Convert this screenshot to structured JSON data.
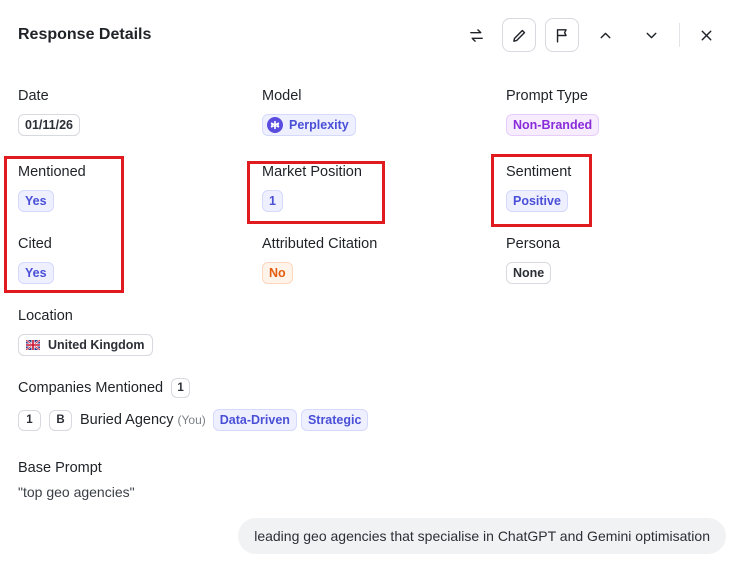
{
  "header": {
    "title": "Response Details",
    "icons": [
      "swap-arrows-icon",
      "pencil-icon",
      "flag-icon",
      "chevron-up-icon",
      "chevron-down-icon",
      "close-icon"
    ]
  },
  "fields": {
    "date": {
      "label": "Date",
      "value": "01/11/26"
    },
    "model": {
      "label": "Model",
      "value": "Perplexity"
    },
    "prompt_type": {
      "label": "Prompt Type",
      "value": "Non-Branded"
    },
    "mentioned": {
      "label": "Mentioned",
      "value": "Yes"
    },
    "market_position": {
      "label": "Market Position",
      "value": "1"
    },
    "sentiment": {
      "label": "Sentiment",
      "value": "Positive"
    },
    "cited": {
      "label": "Cited",
      "value": "Yes"
    },
    "attributed_citation": {
      "label": "Attributed Citation",
      "value": "No"
    },
    "persona": {
      "label": "Persona",
      "value": "None"
    },
    "location": {
      "label": "Location",
      "value": "United Kingdom"
    }
  },
  "companies": {
    "label": "Companies Mentioned",
    "count": "1",
    "items": [
      {
        "rank": "1",
        "initial": "B",
        "name": "Buried Agency",
        "suffix": "(You)",
        "tags": [
          "Data-Driven",
          "Strategic"
        ]
      }
    ]
  },
  "base_prompt": {
    "label": "Base Prompt",
    "value": "\"top geo agencies\""
  },
  "chat": {
    "message": "leading geo agencies that specialise in ChatGPT and Gemini optimisation"
  },
  "colors": {
    "highlight": "#e01a1f",
    "accent_blue": "#4a4fd6",
    "accent_purple": "#8a2bd9",
    "accent_orange": "#e25d0f"
  }
}
